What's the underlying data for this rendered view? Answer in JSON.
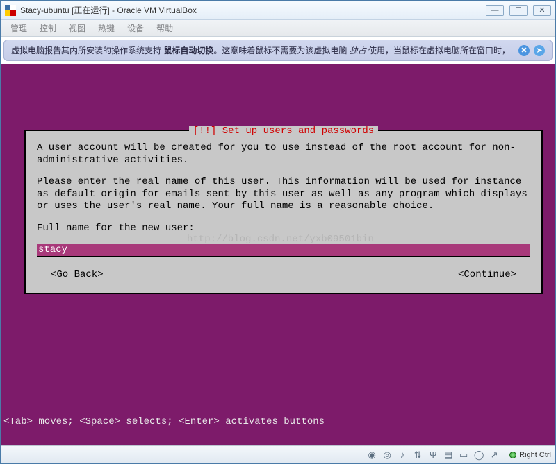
{
  "window": {
    "title": "Stacy-ubuntu [正在运行] - Oracle VM VirtualBox",
    "controls": {
      "minimize": "—",
      "maximize": "☐",
      "close": "✕"
    }
  },
  "menu": {
    "items": [
      "管理",
      "控制",
      "视图",
      "热键",
      "设备",
      "帮助"
    ]
  },
  "banner": {
    "prefix": "虚拟电脑报告其内所安装的操作系统支持 ",
    "bold": "鼠标自动切换",
    "mid": "。这意味着鼠标不需要为该虚拟电脑 ",
    "italic": "独占",
    "suffix": " 使用，当鼠标在虚拟电脑所在窗口时，"
  },
  "installer": {
    "title": "[!!] Set up users and passwords",
    "para1": "A user account will be created for you to use instead of the root account for non-administrative activities.",
    "para2": "Please enter the real name of this user. This information will be used for instance as default origin for emails sent by this user as well as any program which displays or uses the user's real name. Your full name is a reasonable choice.",
    "prompt": "Full name for the new user:",
    "value": "stacy",
    "go_back": "<Go Back>",
    "continue": "<Continue>"
  },
  "watermark": "http://blog.csdn.net/yxb09501bin",
  "keyhint": "<Tab> moves; <Space> selects; <Enter> activates buttons",
  "statusbar": {
    "hostkey": "Right Ctrl"
  }
}
